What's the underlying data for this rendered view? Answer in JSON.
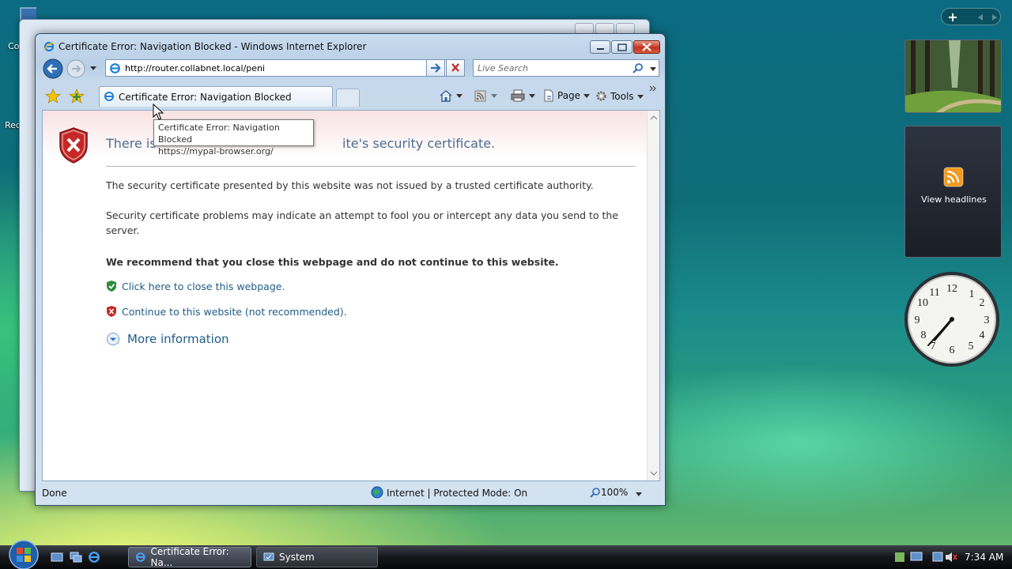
{
  "window": {
    "title": "Certificate Error: Navigation Blocked - Windows Internet Explorer",
    "address": "http://router.collabnet.local/peni",
    "search_placeholder": "Live Search",
    "tab_title": "Certificate Error: Navigation Blocked",
    "page_label": "Page",
    "tools_label": "Tools"
  },
  "content": {
    "heading_left": "There is",
    "heading_right": "ite's security certificate.",
    "para1": "The security certificate presented by this website was not issued by a trusted certificate authority.",
    "para2": "Security certificate problems may indicate an attempt to fool you or intercept any data you send to the server.",
    "recommend": "We recommend that you close this webpage and do not continue to this website.",
    "close_link": "Click here to close this webpage.",
    "continue_link": "Continue to this website (not recommended).",
    "more_info": "More information"
  },
  "tooltip": {
    "line1": "Certificate Error: Navigation Blocked",
    "line2": "https://mypal-browser.org/"
  },
  "status": {
    "left": "Done",
    "zone": "Internet | Protected Mode: On",
    "zoom": "100%"
  },
  "desktop": {
    "label1": "Co",
    "label2": "Rec"
  },
  "sidebar": {
    "feed_label": "View headlines"
  },
  "taskbar": {
    "task1": "Certificate Error: Na...",
    "task2": "System",
    "clock": "7:34 AM"
  },
  "colors": {
    "link": "#1f5c8a",
    "heading": "#4b6e93",
    "error_red": "#c62828",
    "safe_green": "#2e8b3a"
  }
}
